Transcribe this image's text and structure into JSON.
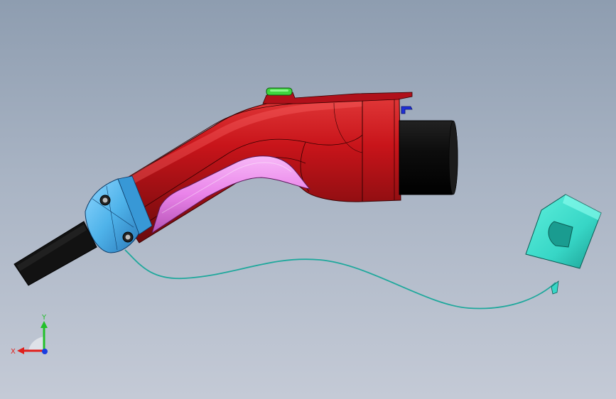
{
  "viewport": {
    "background_top": "#8e9db0",
    "background_bottom": "#c4cad6"
  },
  "model": {
    "handle_color": "#c8141a",
    "grip_color": "#e983e9",
    "collar_color": "#4fb3ea",
    "cable_color": "#111111",
    "nozzle_color": "#0d0d0d",
    "release_button_color": "#3ed43e",
    "latch_color": "#1e2fd8",
    "cap_color": "#37d6c6",
    "tether_color": "#1fa89c"
  },
  "triad": {
    "x_label": "X",
    "y_label": "Y",
    "x_color": "#e0201c",
    "y_color": "#22c02a",
    "z_color": "#1a3ee0"
  }
}
